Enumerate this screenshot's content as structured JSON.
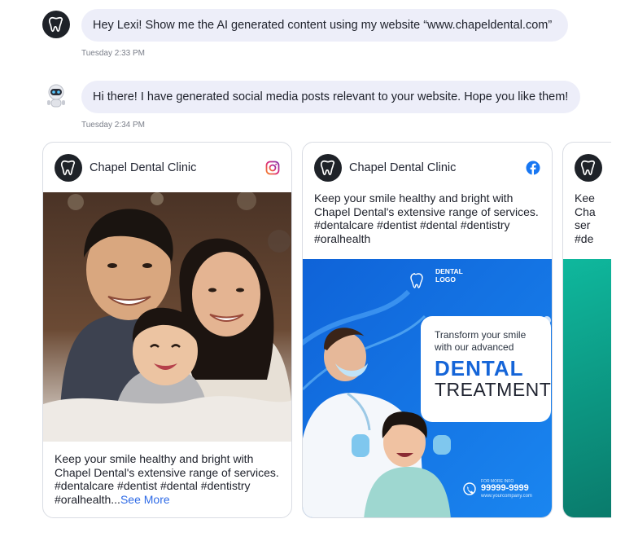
{
  "chat": {
    "user_message": "Hey Lexi! Show me the AI generated content using my website “www.chapeldental.com”",
    "user_time": "Tuesday 2:33 PM",
    "bot_message": "Hi there! I have generated social media posts relevant to your website. Hope you like them!",
    "bot_time": "Tuesday 2:34 PM"
  },
  "posts": [
    {
      "brand": "Chapel Dental Clinic",
      "platform": "instagram-icon",
      "caption": "Keep your smile healthy and bright with Chapel Dental's extensive range of services. #dentalcare #dentist #dental #dentistry #oralhealth...",
      "see_more": "See More"
    },
    {
      "brand": "Chapel Dental Clinic",
      "platform": "facebook-icon",
      "caption": "Keep your smile healthy and bright with Chapel Dental's extensive range of services. #dentalcare #dentist #dental #dentistry #oralhealth",
      "promo": {
        "logo_line1": "DENTAL",
        "logo_line2": "LOGO",
        "tagline_line1": "Transform your smile",
        "tagline_line2": "with our advanced",
        "headline1": "DENTAL",
        "headline2": "TREATMENT",
        "more_info": "FOR MORE INFO",
        "phone": "99999-9999",
        "website": "www.yourcompany.com"
      }
    },
    {
      "caption_fragments": [
        "Kee",
        "Cha",
        "ser",
        "#de"
      ]
    }
  ],
  "colors": {
    "bubble": "#edeef9",
    "link": "#2f6be6",
    "facebook": "#1877f2",
    "instagram": "#c13584",
    "promo_blue": "#1a73e8"
  }
}
